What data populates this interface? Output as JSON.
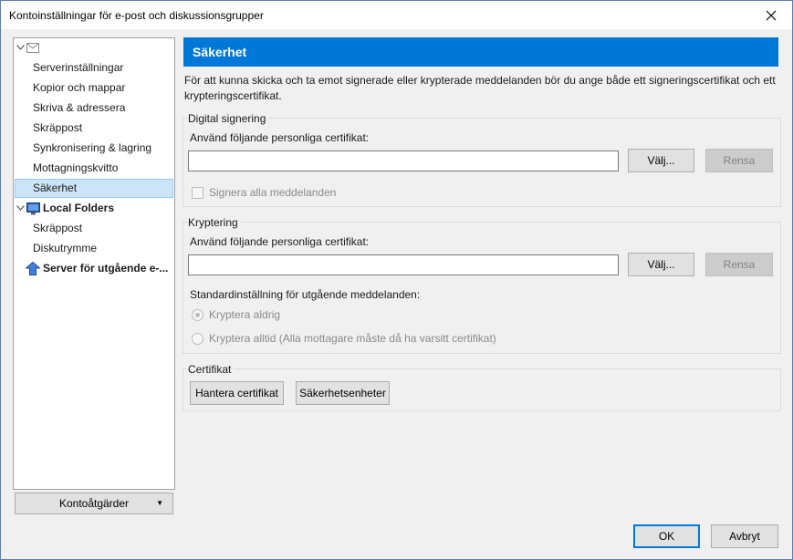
{
  "window": {
    "title": "Kontoinställningar för e-post och diskussionsgrupper"
  },
  "tree": {
    "items": [
      {
        "label": ""
      },
      {
        "label": "Serverinställningar"
      },
      {
        "label": "Kopior och mappar"
      },
      {
        "label": "Skriva & adressera"
      },
      {
        "label": "Skräppost"
      },
      {
        "label": "Synkronisering & lagring"
      },
      {
        "label": "Mottagningskvitto"
      },
      {
        "label": "Säkerhet"
      },
      {
        "label": "Local Folders"
      },
      {
        "label": "Skräppost"
      },
      {
        "label": "Diskutrymme"
      },
      {
        "label": "Server för utgående e-..."
      }
    ],
    "account_actions": "Kontoåtgärder"
  },
  "content": {
    "header": "Säkerhet",
    "description": "För att kunna skicka och ta emot signerade eller krypterade meddelanden bör du ange både ett signeringscertifikat och ett krypteringscertifikat.",
    "signing": {
      "legend": "Digital signering",
      "cert_label": "Använd följande personliga certifikat:",
      "cert_value": "",
      "choose": "Välj...",
      "clear": "Rensa",
      "sign_all": "Signera alla meddelanden"
    },
    "encryption": {
      "legend": "Kryptering",
      "cert_label": "Använd följande personliga certifikat:",
      "cert_value": "",
      "choose": "Välj...",
      "clear": "Rensa",
      "default_label": "Standardinställning för utgående meddelanden:",
      "never": "Kryptera aldrig",
      "always": "Kryptera alltid (Alla mottagare måste då ha varsitt certifikat)"
    },
    "certificates": {
      "legend": "Certifikat",
      "manage": "Hantera certifikat",
      "devices": "Säkerhetsenheter"
    }
  },
  "footer": {
    "ok": "OK",
    "cancel": "Avbryt"
  },
  "colors": {
    "accent": "#0078d7",
    "selection": "#cce4f7"
  }
}
